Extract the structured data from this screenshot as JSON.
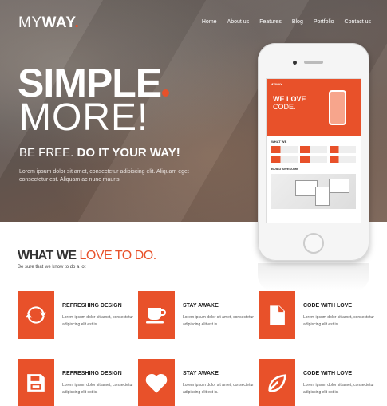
{
  "brand": {
    "logo_part1": "MY",
    "logo_part2": "WAY",
    "logo_dot": ".",
    "accent": "#e8512a"
  },
  "nav": {
    "items": [
      "Home",
      "About us",
      "Features",
      "Blog",
      "Portfolio",
      "Contact us"
    ]
  },
  "hero": {
    "headline": "SIMPLE",
    "subheadline": "MORE!",
    "tag_light": "BE FREE.",
    "tag_bold": "DO IT YOUR WAY!",
    "description": "Lorem ipsum dolor sit amet, consectetur adipiscing elit. Aliquam eget consectetur est. Aliquam ac nunc mauris."
  },
  "phone_screen": {
    "logo": "MYWAY",
    "title_line1": "WE LOVE",
    "title_line2": "CODE.",
    "section_heading": "WHAT WE",
    "devices_heading": "BUILD AWESOME"
  },
  "section": {
    "title_bold": "WHAT WE",
    "title_light": "LOVE TO DO.",
    "subtitle": "Be sure that we know to do a lot"
  },
  "features": [
    {
      "title": "REFRESHING DESIGN",
      "text": "Lorem ipsum dolor sit amet, consectetur adipiscing elit est is.",
      "icon": "refresh-icon"
    },
    {
      "title": "STAY AWAKE",
      "text": "Lorem ipsum dolor sit amet, consectetur adipiscing elit est is.",
      "icon": "coffee-cup-icon"
    },
    {
      "title": "CODE WITH LOVE",
      "text": "Lorem ipsum dolor sit amet, consectetur adipiscing elit est is.",
      "icon": "document-icon"
    },
    {
      "title": "REFRESHING DESIGN",
      "text": "Lorem ipsum dolor sit amet, consectetur adipiscing elit est is.",
      "icon": "floppy-disk-icon"
    },
    {
      "title": "STAY AWAKE",
      "text": "Lorem ipsum dolor sit amet, consectetur adipiscing elit est is.",
      "icon": "heart-icon"
    },
    {
      "title": "CODE WITH LOVE",
      "text": "Lorem ipsum dolor sit amet, consectetur adipiscing elit est is.",
      "icon": "leaf-icon"
    }
  ]
}
